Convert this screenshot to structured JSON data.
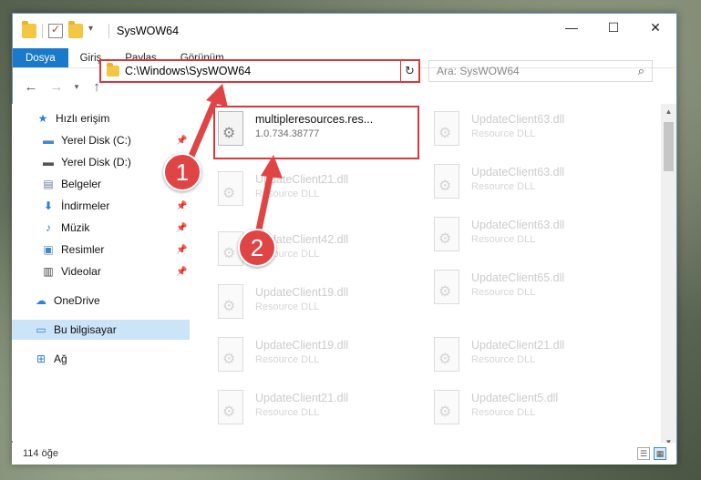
{
  "window": {
    "title": "SysWOW64"
  },
  "ribbon": {
    "tabs": [
      "Dosya",
      "Giriş",
      "Paylaş",
      "Görünüm"
    ]
  },
  "address": {
    "path": "C:\\Windows\\SysWOW64"
  },
  "search": {
    "placeholder": "Ara: SysWOW64"
  },
  "sidebar": {
    "items": [
      {
        "label": "Hızlı erişim",
        "icon": "star-icon"
      },
      {
        "label": "Yerel Disk (C:)",
        "icon": "drive-icon"
      },
      {
        "label": "Yerel Disk (D:)",
        "icon": "drive-icon"
      },
      {
        "label": "Belgeler",
        "icon": "documents-icon"
      },
      {
        "label": "İndirmeler",
        "icon": "download-icon"
      },
      {
        "label": "Müzik",
        "icon": "music-icon"
      },
      {
        "label": "Resimler",
        "icon": "pictures-icon"
      },
      {
        "label": "Videolar",
        "icon": "video-icon"
      },
      {
        "label": "OneDrive",
        "icon": "cloud-icon"
      },
      {
        "label": "Bu bilgisayar",
        "icon": "computer-icon"
      },
      {
        "label": "Ağ",
        "icon": "network-icon"
      }
    ]
  },
  "files": {
    "left": [
      {
        "name": "multipleresources.res...",
        "desc": "1.0.734.38777"
      },
      {
        "name": "UpdateClient21.dll",
        "desc": "Resource DLL"
      },
      {
        "name": "UpdateClient42.dll",
        "desc": "Resource DLL"
      },
      {
        "name": "UpdateClient19.dll",
        "desc": "Resource DLL"
      },
      {
        "name": "UpdateClient19.dll",
        "desc": "Resource DLL"
      },
      {
        "name": "UpdateClient21.dll",
        "desc": "Resource DLL"
      }
    ],
    "right": [
      {
        "name": "UpdateClient63.dll",
        "desc": "Resource DLL"
      },
      {
        "name": "UpdateClient63.dll",
        "desc": "Resource DLL"
      },
      {
        "name": "UpdateClient63.dll",
        "desc": "Resource DLL"
      },
      {
        "name": "UpdateClient65.dll",
        "desc": "Resource DLL"
      },
      {
        "name": "UpdateClient21.dll",
        "desc": "Resource DLL"
      },
      {
        "name": "UpdateClient5.dll",
        "desc": "Resource DLL"
      }
    ]
  },
  "status": {
    "count": "114 öğe"
  },
  "annotations": {
    "step1": "1",
    "step2": "2",
    "color": "#e04545"
  }
}
